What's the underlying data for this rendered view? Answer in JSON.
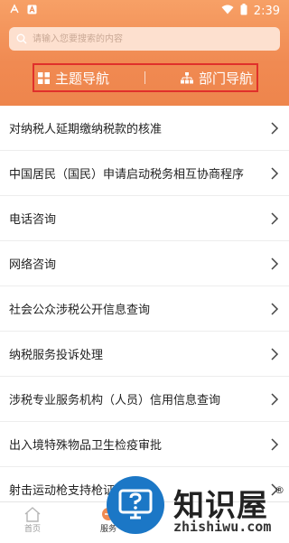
{
  "status_bar": {
    "time": "2:39",
    "icons": [
      "app-icon",
      "a-notification-icon",
      "wifi-icon",
      "battery-icon"
    ]
  },
  "search": {
    "placeholder": "请输入您要搜索的内容"
  },
  "nav_tabs": [
    {
      "label": "主题导航",
      "icon": "grid-icon"
    },
    {
      "label": "部门导航",
      "icon": "org-chart-icon"
    }
  ],
  "list_items": [
    {
      "label": "对纳税人延期缴纳税款的核准"
    },
    {
      "label": "中国居民（国民）申请启动税务相互协商程序"
    },
    {
      "label": "电话咨询"
    },
    {
      "label": "网络咨询"
    },
    {
      "label": "社会公众涉税公开信息查询"
    },
    {
      "label": "纳税服务投诉处理"
    },
    {
      "label": "涉税专业服务机构（人员）信用信息查询"
    },
    {
      "label": "出入境特殊物品卫生检疫审批"
    },
    {
      "label": "射击运动枪支持枪证初"
    }
  ],
  "bottom_nav": [
    {
      "label": "首页",
      "icon": "home-icon"
    },
    {
      "label": "服务",
      "icon": "service-icon"
    }
  ],
  "watermark": {
    "name": "知识屋",
    "reg": "®",
    "url": "zhishiwu.com"
  },
  "colors": {
    "header": "#f08a52",
    "highlight_box": "#e0302b",
    "watermark_circle": "#1b77c6"
  }
}
